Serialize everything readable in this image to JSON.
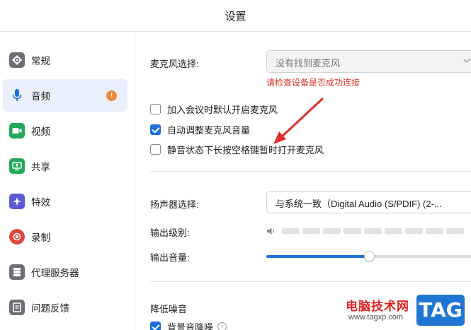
{
  "window": {
    "title": "设置"
  },
  "sidebar": {
    "items": [
      {
        "label": "常规",
        "icon": "gear-icon",
        "color": "#6b6f76"
      },
      {
        "label": "音频",
        "icon": "microphone-icon",
        "color": "#1f6fd8",
        "active": true,
        "badge": "!"
      },
      {
        "label": "视频",
        "icon": "camera-icon",
        "color": "#21a95a"
      },
      {
        "label": "共享",
        "icon": "share-screen-icon",
        "color": "#21a95a"
      },
      {
        "label": "特效",
        "icon": "sparkle-icon",
        "color": "#5b5bd6"
      },
      {
        "label": "录制",
        "icon": "record-icon",
        "color": "#e2473d"
      },
      {
        "label": "代理服务器",
        "icon": "server-icon",
        "color": "#6b6f76"
      },
      {
        "label": "问题反馈",
        "icon": "feedback-icon",
        "color": "#6b6f76"
      }
    ]
  },
  "audio": {
    "mic_label": "麦克风选择:",
    "mic_value": "没有找到麦克风",
    "mic_error": "请检查设备是否成功连接",
    "options": [
      {
        "label": "加入会议时默认开启麦克风",
        "checked": false
      },
      {
        "label": "自动调整麦克风音量",
        "checked": true
      },
      {
        "label": "静音状态下长按空格键暂时打开麦克风",
        "checked": false
      }
    ],
    "speaker_label": "扬声器选择:",
    "speaker_value": "与系统一致（Digital Audio (S/PDIF) (2-...",
    "output_level_label": "输出级别:",
    "output_volume_label": "输出音量:",
    "output_volume": 0.5,
    "noise_title": "降低噪音",
    "noise_option": {
      "label": "背景音降噪",
      "checked": true
    }
  },
  "watermark": {
    "text": "电脑技术网",
    "url": "www.tagxp.com",
    "tag": "TAG"
  },
  "colors": {
    "accent": "#1f6fd8",
    "error": "#d9352b",
    "badge": "#f0893a",
    "annotation_arrow": "#e0302a"
  }
}
